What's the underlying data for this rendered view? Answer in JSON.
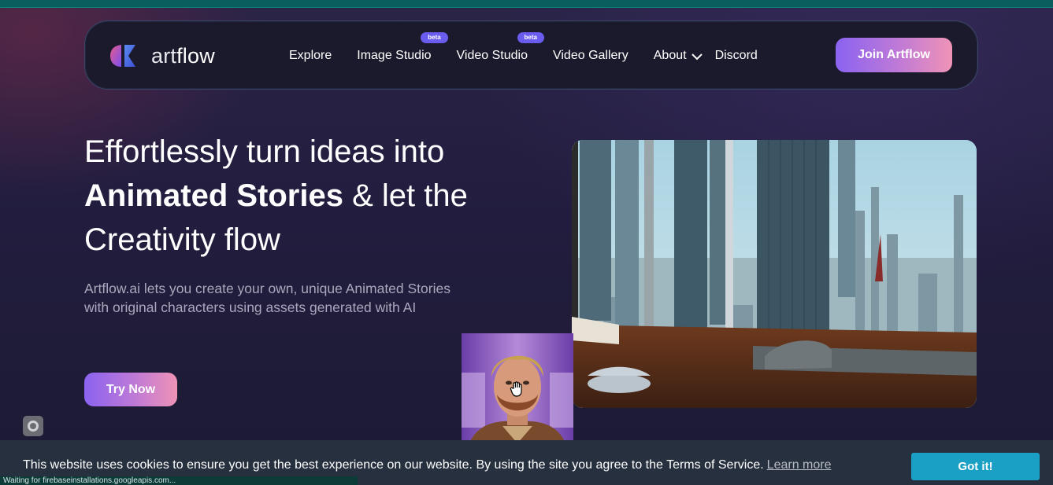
{
  "nav": {
    "logo_text_art": "art",
    "logo_text_flow": "flow",
    "items": [
      {
        "label": "Explore"
      },
      {
        "label": "Image Studio",
        "badge": "beta"
      },
      {
        "label": "Video Studio",
        "badge": "beta"
      },
      {
        "label": "Video Gallery"
      },
      {
        "label": "About"
      },
      {
        "label": "Discord"
      }
    ],
    "join_label": "Join Artflow"
  },
  "hero": {
    "headline_line1": "Effortlessly turn ideas into",
    "headline_bold": "Animated Stories",
    "headline_rest": " & let the",
    "headline_line3": "Creativity flow",
    "subtext_line1": "Artflow.ai lets you create your own, unique Animated Stories",
    "subtext_line2": "with original characters using assets generated with AI",
    "try_label": "Try Now"
  },
  "cookie": {
    "message": "This website uses cookies to ensure you get the best experience on our website. By using the site you agree to the Terms of Service.",
    "learn_more": "Learn more",
    "button": "Got it!"
  },
  "status": {
    "text": "Waiting for firebaseinstallations.googleapis.com..."
  },
  "colors": {
    "accent_start": "#8a63f0",
    "accent_end": "#ef93b6",
    "beta_badge": "#6b5cf0",
    "cookie_button": "#1aa0c4"
  },
  "icons": {
    "logo": "artflow-logo-icon",
    "about_dropdown": "chevron-down-icon",
    "cursor": "hand-cursor-icon",
    "floating": "record-icon"
  }
}
